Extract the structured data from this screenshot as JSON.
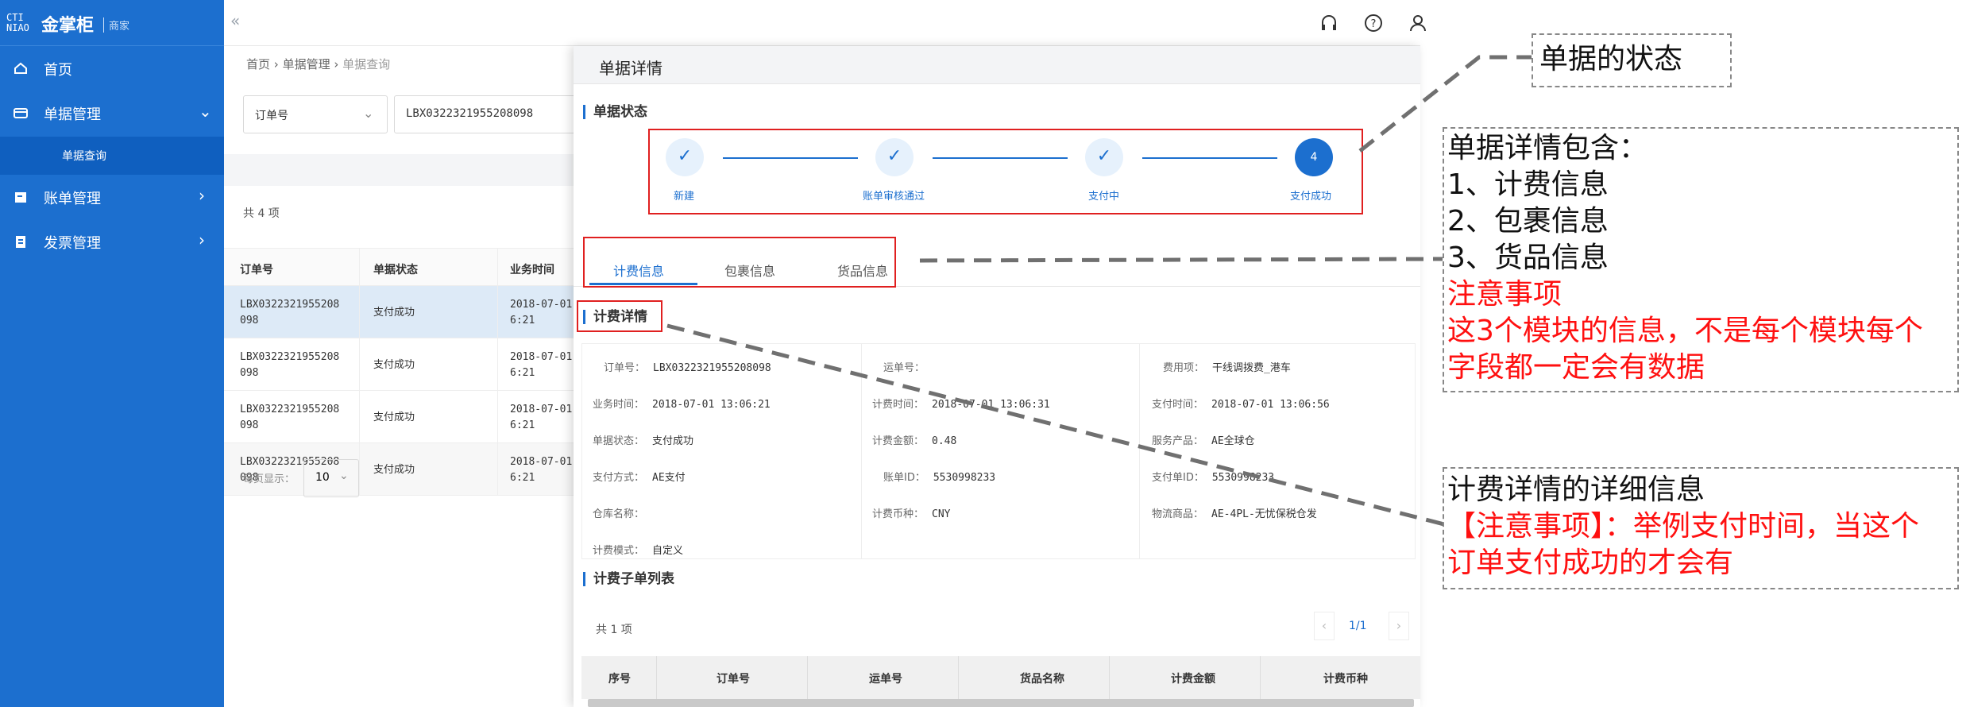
{
  "app": {
    "logo_mark": "CTI\nNIAO",
    "title": "金掌柜",
    "subtitle": "商家"
  },
  "sidebar": {
    "items": [
      {
        "label": "首页",
        "icon": "home-icon"
      },
      {
        "label": "单据管理",
        "icon": "ticket-icon",
        "expanded": true,
        "children": [
          {
            "label": "单据查询"
          }
        ]
      },
      {
        "label": "账单管理",
        "icon": "bill-icon"
      },
      {
        "label": "发票管理",
        "icon": "invoice-icon"
      }
    ]
  },
  "topbar": {
    "collapse": "«",
    "icons": [
      "headset-icon",
      "help-icon",
      "user-icon"
    ]
  },
  "breadcrumb": [
    "首页",
    "单据管理",
    "单据查询"
  ],
  "search": {
    "field_label": "订单号",
    "value": "LBX0322321955208098"
  },
  "list": {
    "count": "共 4 项",
    "columns": [
      "订单号",
      "单据状态",
      "业务时间"
    ],
    "rows": [
      {
        "order": "LBX0322321955208",
        "order2": "098",
        "status": "支付成功",
        "time": "2018-07-01",
        "time2": "6:21"
      },
      {
        "order": "LBX0322321955208",
        "order2": "098",
        "status": "支付成功",
        "time": "2018-07-01",
        "time2": "6:21"
      },
      {
        "order": "LBX0322321955208",
        "order2": "098",
        "status": "支付成功",
        "time": "2018-07-01",
        "time2": "6:21"
      },
      {
        "order": "LBX0322321955208",
        "order2": "098",
        "status": "支付成功",
        "time": "2018-07-01",
        "time2": "6:21"
      }
    ],
    "page_size_label": "每页显示：",
    "page_size": "10"
  },
  "drawer": {
    "title": "单据详情",
    "status_title": "单据状态",
    "steps": [
      {
        "label": "新建",
        "done": true
      },
      {
        "label": "账单审核通过",
        "done": true
      },
      {
        "label": "支付中",
        "done": true
      },
      {
        "label": "支付成功",
        "num": "4",
        "active": true
      }
    ],
    "tabs": [
      "计费信息",
      "包裹信息",
      "货品信息"
    ],
    "billing_title": "计费详情",
    "billing_fields": {
      "col1": [
        [
          "订单号：",
          "LBX0322321955208098"
        ],
        [
          "业务时间：",
          "2018-07-01 13:06:21"
        ],
        [
          "单据状态：",
          "支付成功"
        ],
        [
          "支付方式：",
          "AE支付"
        ],
        [
          "仓库名称：",
          ""
        ],
        [
          "计费模式：",
          "自定义"
        ]
      ],
      "col2": [
        [
          "运单号：",
          ""
        ],
        [
          "计费时间：",
          "2018-07-01 13:06:31"
        ],
        [
          "计费金额：",
          "0.48"
        ],
        [
          "账单ID：",
          "5530998233"
        ],
        [
          "计费币种：",
          "CNY"
        ]
      ],
      "col3": [
        [
          "费用项：",
          "干线调拨费_港车"
        ],
        [
          "支付时间：",
          "2018-07-01 13:06:56"
        ],
        [
          "服务产品：",
          "AE全球仓"
        ],
        [
          "支付单ID：",
          "5530998233"
        ],
        [
          "物流商品：",
          "AE-4PL-无忧保税仓发"
        ]
      ]
    },
    "sub_title": "计费子单列表",
    "sub_count": "共 1 项",
    "sub_page": "1/1",
    "sub_columns": [
      "序号",
      "订单号",
      "运单号",
      "货品名称",
      "计费金额",
      "计费币种"
    ]
  },
  "annotations": {
    "a1": "单据的状态",
    "a2": [
      "单据详情包含：",
      "1、计费信息",
      "2、包裹信息",
      "3、货品信息"
    ],
    "a2_red": [
      "注意事项",
      "这3个模块的信息，不是每个模块每个",
      "字段都一定会有数据"
    ],
    "a3": "计费详情的详细信息",
    "a3_red": [
      "【注意事项】：举例支付时间，当这个",
      "订单支付成功的才会有"
    ]
  },
  "colors": {
    "primary": "#1c6fcf",
    "annotation_red": "#e02020",
    "note_red": "#ff1010"
  }
}
